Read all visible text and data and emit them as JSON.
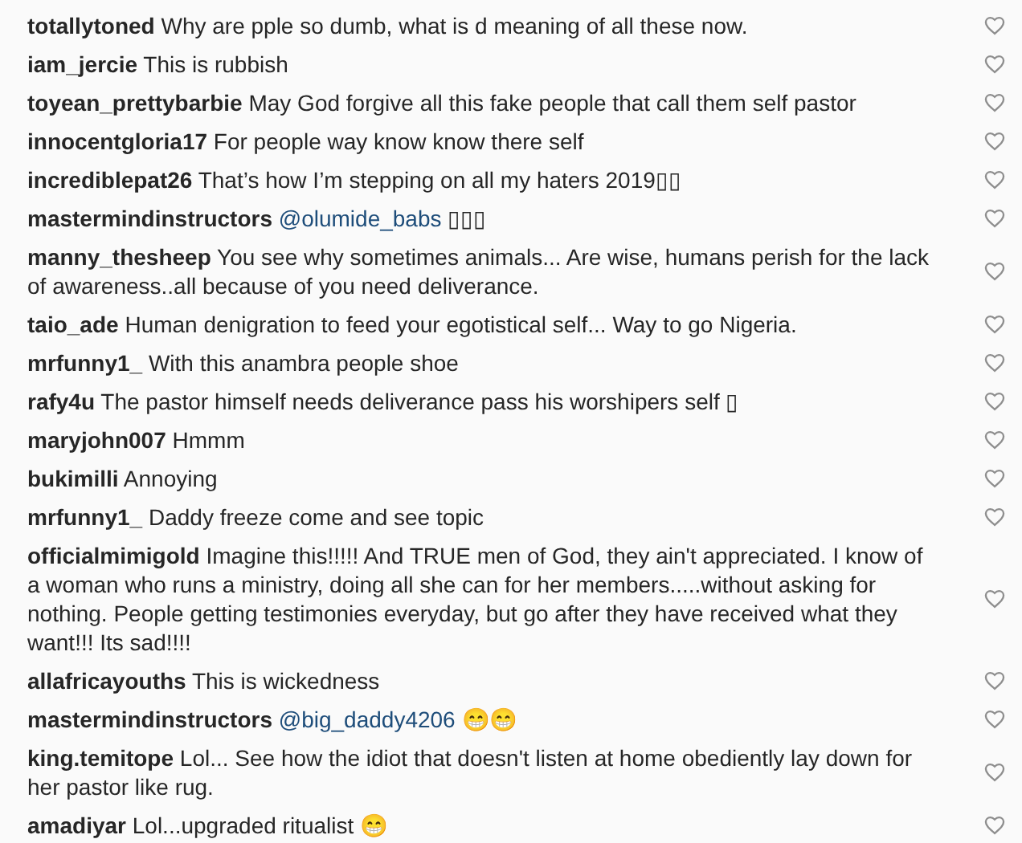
{
  "comments": [
    {
      "user": "totallytoned",
      "text": "Why are pple so dumb, what is d meaning of all these now."
    },
    {
      "user": "iam_jercie",
      "text": "This is rubbish"
    },
    {
      "user": "toyean_prettybarbie",
      "text": "May God forgive all this fake people that call them self pastor"
    },
    {
      "user": "innocentgloria17",
      "text": "For people way know know there self"
    },
    {
      "user": "incrediblepat26",
      "text": "That’s how I’m stepping on all my haters 2019▯▯"
    },
    {
      "user": "mastermindinstructors",
      "mention": "@olumide_babs",
      "text": "▯▯▯"
    },
    {
      "user": "manny_thesheep",
      "text": "You see why sometimes animals... Are wise, humans perish for the lack of awareness..all because of you need deliverance."
    },
    {
      "user": "taio_ade",
      "text": "Human denigration to feed your egotistical self... Way to go Nigeria."
    },
    {
      "user": "mrfunny1_",
      "text": "With this anambra people shoe"
    },
    {
      "user": "rafy4u",
      "text": "The pastor himself needs deliverance pass his worshipers self ▯"
    },
    {
      "user": "maryjohn007",
      "text": "Hmmm"
    },
    {
      "user": "bukimilli",
      "text": "Annoying"
    },
    {
      "user": "mrfunny1_",
      "text": "Daddy freeze come and see topic"
    },
    {
      "user": "officialmimigold",
      "text": "Imagine this!!!!! And TRUE men of God, they ain't appreciated. I know of a woman who runs a ministry, doing all she can for her members.....without asking for nothing. People getting testimonies everyday, but go after they have received what they want!!! Its sad!!!!"
    },
    {
      "user": "allafricayouths",
      "text": "This is wickedness"
    },
    {
      "user": "mastermindinstructors",
      "mention": "@big_daddy4206",
      "text": "😁😁"
    },
    {
      "user": "king.temitope",
      "text": "Lol... See how the idiot that doesn't listen at home obediently lay down for her pastor like rug."
    },
    {
      "user": "amadiyar",
      "text": "Lol...upgraded ritualist 😁"
    }
  ]
}
